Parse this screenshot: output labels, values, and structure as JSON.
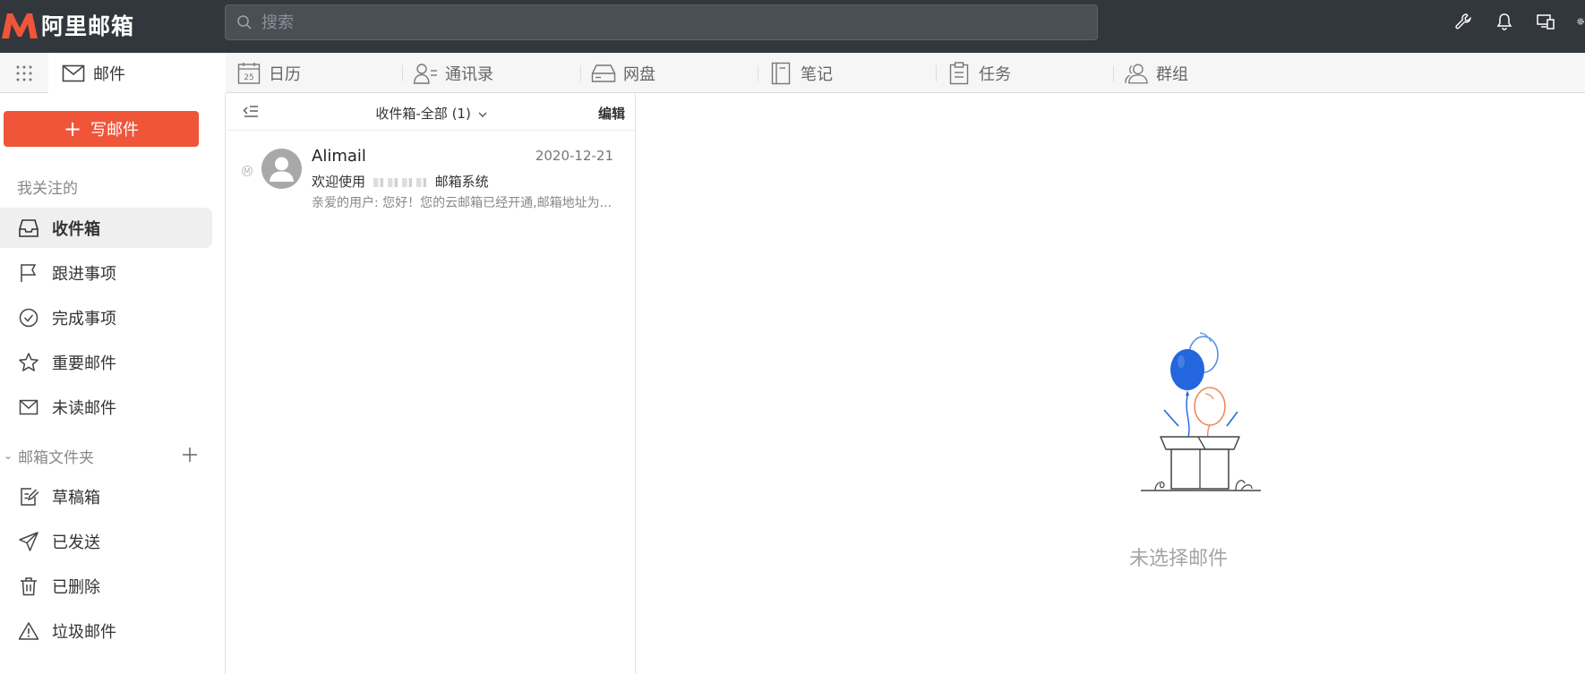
{
  "app": {
    "logo_text": "阿里邮箱",
    "brand_color": "#f0553a"
  },
  "search": {
    "placeholder": "搜索"
  },
  "top_icons": [
    "wrench-icon",
    "bell-icon",
    "devices-icon",
    "settings-icon"
  ],
  "modules": [
    {
      "label": "邮件",
      "icon": "envelope-icon",
      "active": true
    },
    {
      "label": "日历",
      "icon": "calendar-icon",
      "badge": "25"
    },
    {
      "label": "通讯录",
      "icon": "contacts-icon"
    },
    {
      "label": "网盘",
      "icon": "drive-icon"
    },
    {
      "label": "笔记",
      "icon": "notebook-icon"
    },
    {
      "label": "任务",
      "icon": "clipboard-icon"
    },
    {
      "label": "群组",
      "icon": "group-icon"
    }
  ],
  "sidebar": {
    "compose_label": "写邮件",
    "favorites_heading": "我关注的",
    "favorites": [
      {
        "label": "收件箱",
        "icon": "inbox-icon",
        "active": true
      },
      {
        "label": "跟进事项",
        "icon": "flag-icon"
      },
      {
        "label": "完成事项",
        "icon": "check-circle-icon"
      },
      {
        "label": "重要邮件",
        "icon": "star-icon"
      },
      {
        "label": "未读邮件",
        "icon": "envelope-icon"
      }
    ],
    "folders_heading": "邮箱文件夹",
    "folders": [
      {
        "label": "草稿箱",
        "icon": "draft-icon"
      },
      {
        "label": "已发送",
        "icon": "send-icon"
      },
      {
        "label": "已删除",
        "icon": "trash-icon"
      },
      {
        "label": "垃圾邮件",
        "icon": "warning-icon"
      }
    ]
  },
  "mail_list": {
    "folder_title": "收件箱-全部 (1)",
    "edit_label": "编辑",
    "messages": [
      {
        "sender": "Alimail",
        "date": "2020-12-21",
        "subject_prefix": "欢迎使用",
        "subject_suffix": "邮箱系统",
        "preview": "亲爱的用户:    您好！您的云邮箱已经开通,邮箱地址为..."
      }
    ]
  },
  "reader": {
    "empty_text": "未选择邮件"
  }
}
